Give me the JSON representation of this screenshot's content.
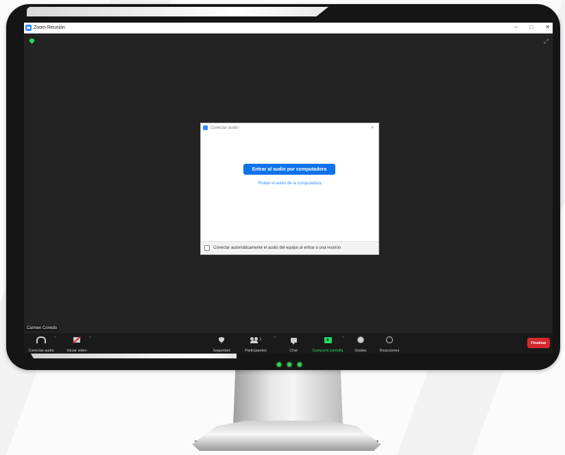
{
  "window": {
    "title": "Zoom Reunión",
    "controls": {
      "minimize": "–",
      "maximize": "□",
      "close": "✕"
    }
  },
  "dialog": {
    "title": "Conectar audio",
    "close": "✕",
    "join_button": "Entrar al audio por computadora",
    "test_link": "Probar el audio de la computadora",
    "auto_connect_label": "Conectar automáticamente el audio del equipo al entrar a una reunión",
    "auto_connect_checked": false
  },
  "participant": {
    "name": "Carmen Conedo"
  },
  "toolbar": {
    "audio": "Conectar audio",
    "video": "Iniciar video",
    "security": "Seguridad",
    "participants": "Participantes",
    "participants_count": "1",
    "chat": "Chat",
    "share": "Compartir pantalla",
    "record": "Grabar",
    "reactions": "Reacciones",
    "end": "Finalizar",
    "caret": "^"
  },
  "icons": [
    "zoom-app-icon",
    "encryption-shield-icon",
    "fullscreen-icon",
    "headphones-icon",
    "video-off-icon",
    "security-shield-icon",
    "participants-icon",
    "chat-icon",
    "share-screen-icon",
    "record-icon",
    "reactions-icon"
  ],
  "colors": {
    "accent_blue": "#0e72ed",
    "share_green": "#23d964",
    "end_red": "#d5292b",
    "meeting_bg": "#232323"
  }
}
